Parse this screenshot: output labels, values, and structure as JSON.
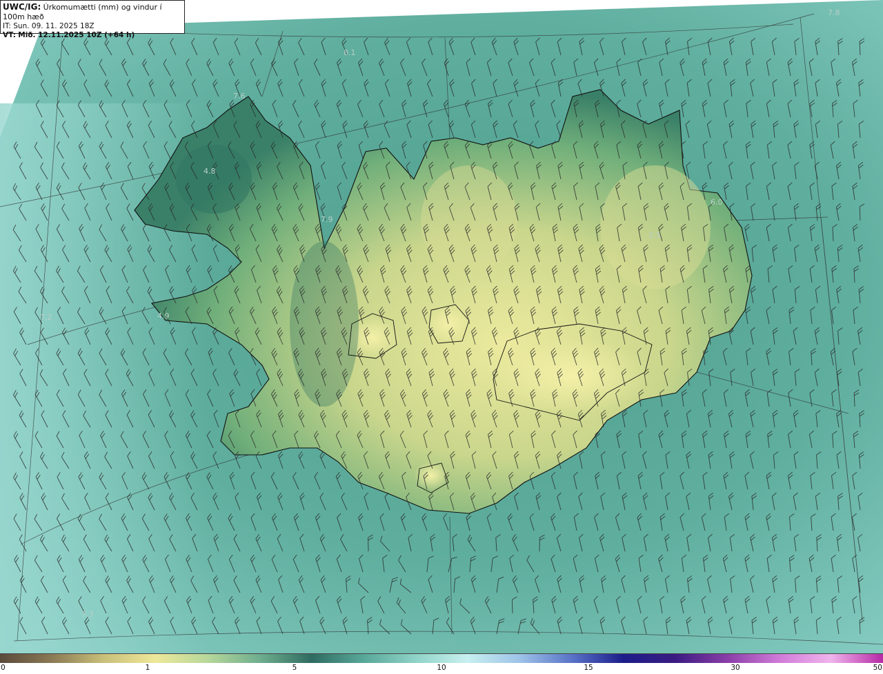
{
  "legend": {
    "code": "UWC/IG:",
    "title": "Úrkomumætti (mm) og vindur í 100m hæð",
    "it_label": "IT:",
    "it_value": "Sun. 09. 11. 2025 18Z",
    "vt_label": "VT:",
    "vt_value": "Mið. 12.11.2025 10Z (+64 h)"
  },
  "colorbar": {
    "ticks": [
      "0",
      "1",
      "5",
      "10",
      "15",
      "30",
      "50"
    ],
    "stops": [
      "#5a4a3a",
      "#8a7a55",
      "#c9c07a",
      "#eee89a",
      "#b7d79a",
      "#6fae8e",
      "#2f6b60",
      "#58a89a",
      "#8fd3c8",
      "#c8f0f0",
      "#9fc4e8",
      "#5a74c8",
      "#1c1d8a",
      "#3a1b82",
      "#8a3ea8",
      "#d07ad8",
      "#f0b4ec",
      "#b52aa6"
    ]
  },
  "colors": {
    "sea_low": "#7dc4b8",
    "sea_mid": "#4f9e8e",
    "land_low": "#2f7460",
    "land_high": "#e8e8a0",
    "coastline": "#101010",
    "barb": "#2a2a2a",
    "grid": "#333333"
  },
  "map": {
    "region": "Iceland",
    "stations": [
      "8.1",
      "7.8",
      "7.6",
      "4.8",
      "7.9",
      "6.0",
      "2.3",
      "4.9",
      "7.2",
      "7.3"
    ]
  }
}
